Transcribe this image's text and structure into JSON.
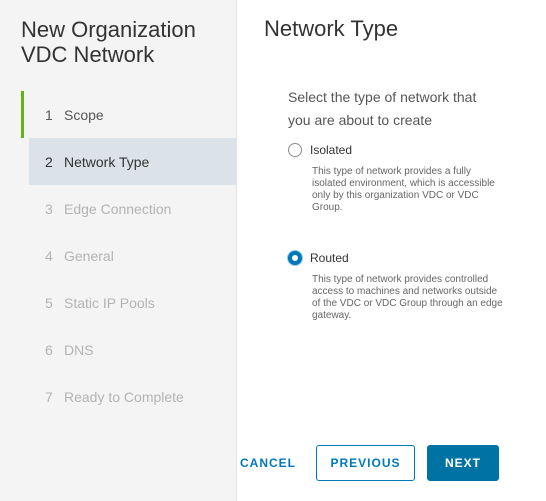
{
  "wizard": {
    "title": "New Organization VDC Network",
    "steps": [
      {
        "number": "1",
        "label": "Scope",
        "state": "complete"
      },
      {
        "number": "2",
        "label": "Network Type",
        "state": "active"
      },
      {
        "number": "3",
        "label": "Edge Connection",
        "state": "disabled"
      },
      {
        "number": "4",
        "label": "General",
        "state": "disabled"
      },
      {
        "number": "5",
        "label": "Static IP Pools",
        "state": "disabled"
      },
      {
        "number": "6",
        "label": "DNS",
        "state": "disabled"
      },
      {
        "number": "7",
        "label": "Ready to Complete",
        "state": "disabled"
      }
    ]
  },
  "page": {
    "title": "Network Type",
    "prompt": "Select the type of network that you are about to create"
  },
  "options": [
    {
      "label": "Isolated",
      "checked": false,
      "description": "This type of network provides a fully isolated environment, which is accessible only by this organization VDC or VDC Group."
    },
    {
      "label": "Routed",
      "checked": true,
      "description": "This type of network provides controlled access to machines and networks outside of the VDC or VDC Group through an edge gateway."
    }
  ],
  "buttons": {
    "cancel": "CANCEL",
    "previous": "PREVIOUS",
    "next": "NEXT"
  },
  "colors": {
    "accent": "#0079b8",
    "primary_button": "#0072a3",
    "complete_step": "#60b515",
    "active_step_bg": "#dbe3e9"
  }
}
